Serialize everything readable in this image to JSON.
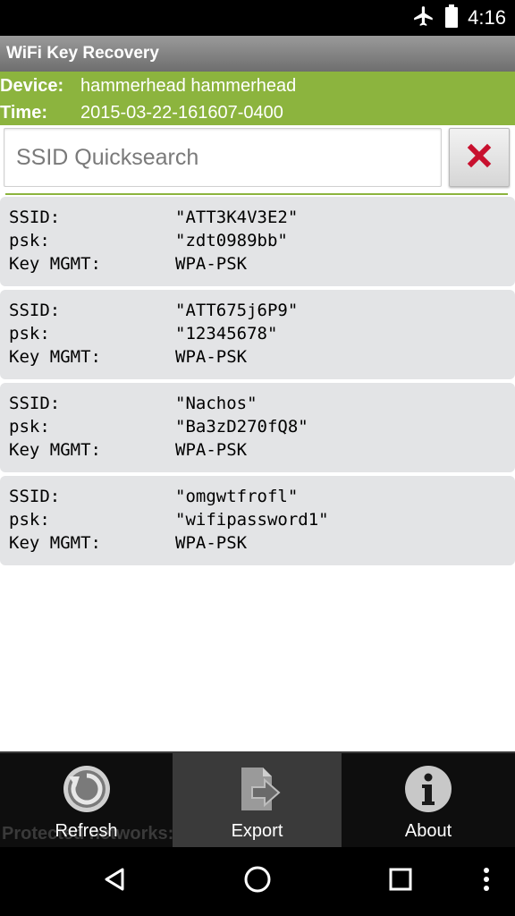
{
  "status_bar": {
    "time": "4:16",
    "icons": [
      "airplane-mode-icon",
      "battery-icon"
    ]
  },
  "app": {
    "title": "WiFi Key Recovery"
  },
  "info": {
    "device_label": "Device:",
    "device_value": "hammerhead hammerhead",
    "time_label": "Time:",
    "time_value": "2015-03-22-161607-0400"
  },
  "search": {
    "placeholder": "SSID Quicksearch",
    "value": ""
  },
  "labels": {
    "ssid": "SSID:",
    "psk": "psk:",
    "key_mgmt": "Key MGMT:"
  },
  "networks": [
    {
      "ssid": "\"ATT3K4V3E2\"",
      "psk": "\"zdt0989bb\"",
      "key_mgmt": "WPA-PSK"
    },
    {
      "ssid": "\"ATT675j6P9\"",
      "psk": "\"12345678\"",
      "key_mgmt": "WPA-PSK"
    },
    {
      "ssid": "\"Nachos\"",
      "psk": "\"Ba3zD270fQ8\"",
      "key_mgmt": "WPA-PSK"
    },
    {
      "ssid": "\"omgwtfrofl\"",
      "psk": "\"wifipassword1\"",
      "key_mgmt": "WPA-PSK"
    }
  ],
  "footer": {
    "text": "Protected networks:  4"
  },
  "menu": {
    "refresh_label": "Refresh",
    "export_label": "Export",
    "about_label": "About"
  },
  "colors": {
    "accent_green": "#8cb43e",
    "card_bg": "#e3e4e6",
    "clear_x_red": "#c8102e"
  }
}
